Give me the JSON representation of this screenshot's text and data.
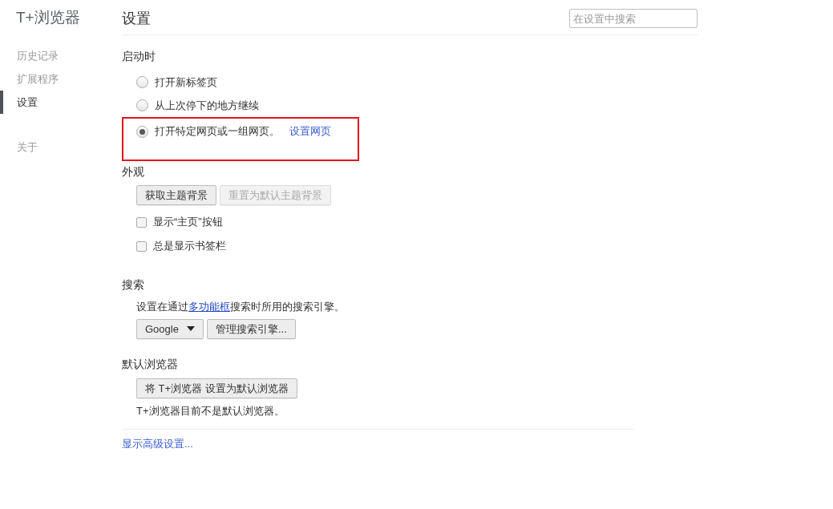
{
  "sidebar": {
    "brand": "T+浏览器",
    "items": [
      {
        "label": "历史记录",
        "selected": false
      },
      {
        "label": "扩展程序",
        "selected": false
      },
      {
        "label": "设置",
        "selected": true
      },
      {
        "label": "关于",
        "selected": false
      }
    ]
  },
  "header": {
    "title": "设置",
    "search": {
      "placeholder": "在设置中搜索"
    }
  },
  "startup": {
    "heading": "启动时",
    "options": [
      {
        "label": "打开新标签页",
        "selected": false,
        "highlighted": false
      },
      {
        "label": "从上次停下的地方继续",
        "selected": false,
        "highlighted": false
      },
      {
        "label": "打开特定网页或一组网页。",
        "selected": true,
        "highlighted": true,
        "link": "设置网页"
      }
    ]
  },
  "appearance": {
    "heading": "外观",
    "buttons": [
      {
        "label": "获取主题背景",
        "disabled": false
      },
      {
        "label": "重置为默认主题背景",
        "disabled": true
      }
    ],
    "checkboxes": [
      {
        "label": "显示“主页”按钮",
        "checked": false
      },
      {
        "label": "总是显示书签栏",
        "checked": false
      }
    ]
  },
  "search": {
    "heading": "搜索",
    "text_before": "设置在通过",
    "link": "多功能框",
    "text_after": "搜索时所用的搜索引擎。",
    "engine": "Google",
    "manage_button": "管理搜索引擎..."
  },
  "default_browser": {
    "heading": "默认浏览器",
    "button": "将 T+浏览器 设置为默认浏览器",
    "status": "T+浏览器目前不是默认浏览器。"
  },
  "advanced_link": "显示高级设置..."
}
